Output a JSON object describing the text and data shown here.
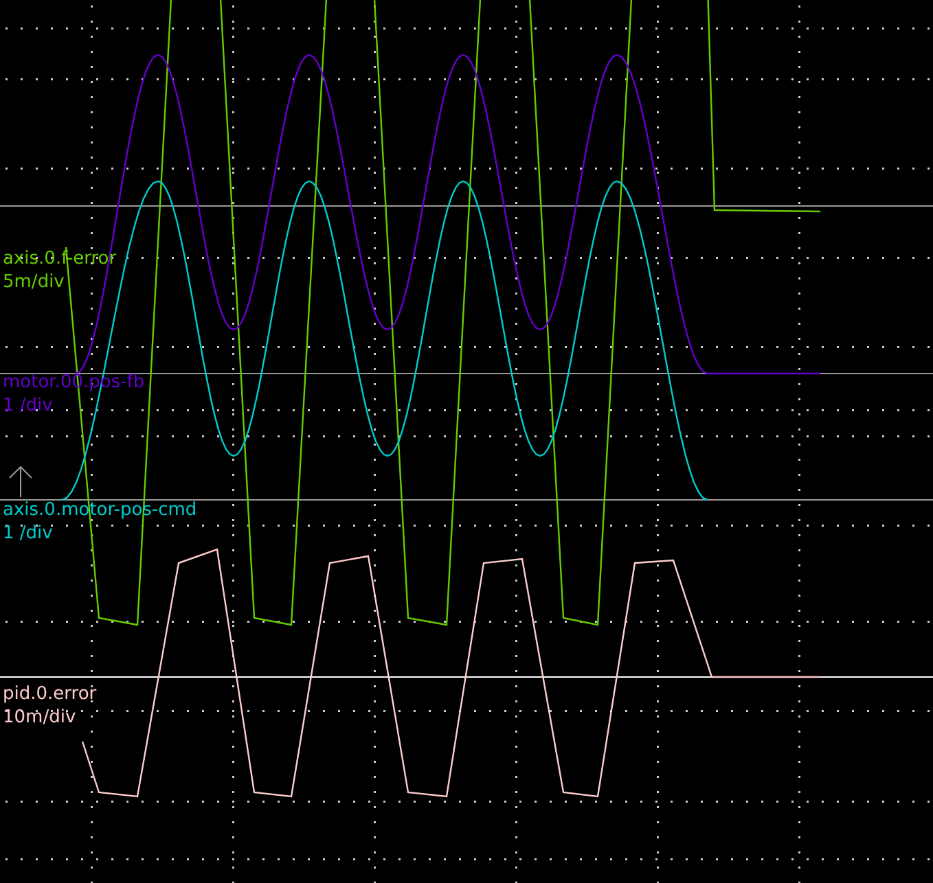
{
  "channels": [
    {
      "name": "axis.0.f-error",
      "scale": "5m/div",
      "color": "#66cc00"
    },
    {
      "name": "motor.00.pos-fb",
      "scale": "1 /div",
      "color": "#6600cc"
    },
    {
      "name": "axis.0.motor-pos-cmd",
      "scale": "1 /div",
      "color": "#00cccc"
    },
    {
      "name": "pid.0.error",
      "scale": "10m/div",
      "color": "#ffcccc"
    }
  ]
}
